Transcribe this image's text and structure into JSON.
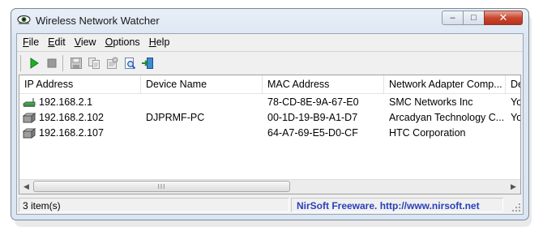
{
  "window": {
    "title": "Wireless Network Watcher",
    "minimize_glyph": "–",
    "maximize_glyph": "□",
    "close_glyph": "✕"
  },
  "menu": [
    {
      "accel": "F",
      "rest": "ile"
    },
    {
      "accel": "E",
      "rest": "dit"
    },
    {
      "accel": "V",
      "rest": "iew"
    },
    {
      "accel": "O",
      "rest": "ptions"
    },
    {
      "accel": "H",
      "rest": "elp"
    }
  ],
  "toolbar": {
    "icons": [
      "play-icon",
      "stop-icon",
      "save-icon",
      "copy-icon",
      "properties-icon",
      "find-icon",
      "exit-icon"
    ]
  },
  "table": {
    "columns": [
      "IP Address",
      "Device Name",
      "MAC Address",
      "Network Adapter Comp...",
      "Dev"
    ],
    "rows": [
      {
        "icon": "router-icon",
        "cells": [
          "192.168.2.1",
          "",
          "78-CD-8E-9A-67-E0",
          "SMC Networks Inc",
          "You"
        ]
      },
      {
        "icon": "computer-icon",
        "cells": [
          "192.168.2.102",
          "DJPRMF-PC",
          "00-1D-19-B9-A1-D7",
          "Arcadyan Technology C...",
          "You"
        ]
      },
      {
        "icon": "computer-icon",
        "cells": [
          "192.168.2.107",
          "",
          "64-A7-69-E5-D0-CF",
          "HTC Corporation",
          ""
        ]
      }
    ]
  },
  "scrollbar": {
    "left_arrow": "◀",
    "right_arrow": "▶",
    "thumb_grip": "III"
  },
  "status": {
    "count": "3 item(s)",
    "link": "NirSoft Freeware.  http://www.nirsoft.net"
  }
}
